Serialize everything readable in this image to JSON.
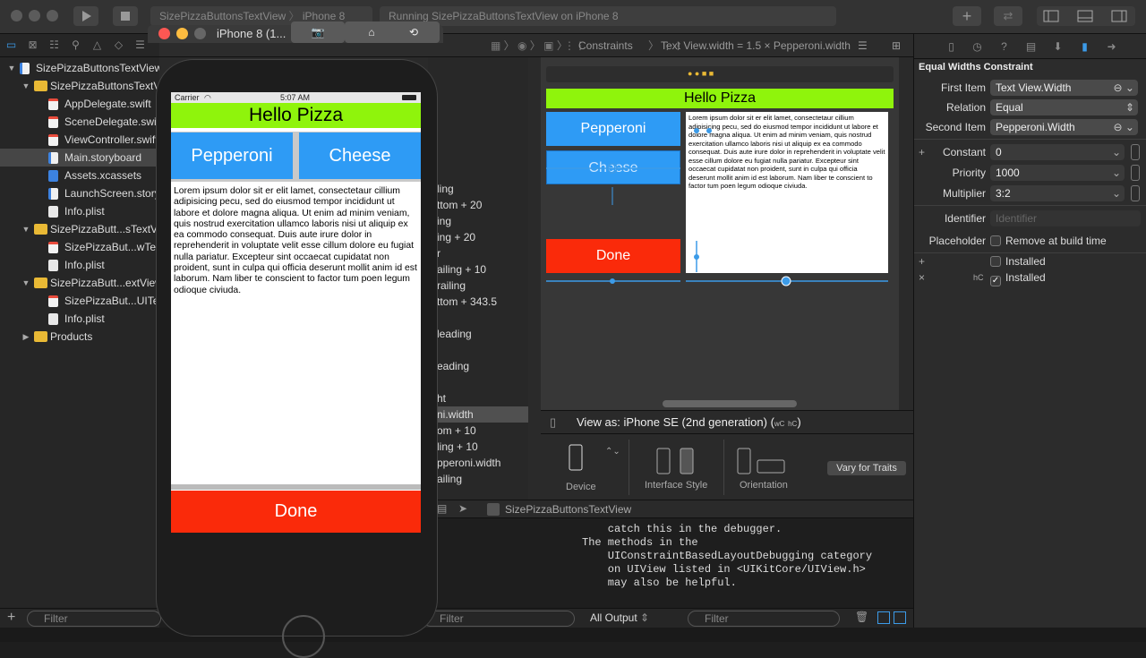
{
  "toolbar": {
    "scheme_left": "SizePizzaButtonsTextView",
    "scheme_device": "iPhone 8",
    "status": "Running SizePizzaButtonsTextView on iPhone 8"
  },
  "navigator": {
    "items": [
      {
        "label": "SizePizzaButtonsTextView",
        "kind": "project",
        "level": 0,
        "open": true
      },
      {
        "label": "SizePizzaButtonsTextView",
        "kind": "folder",
        "level": 1,
        "open": true
      },
      {
        "label": "AppDelegate.swift",
        "kind": "swift",
        "level": 2
      },
      {
        "label": "SceneDelegate.swift",
        "kind": "swift",
        "level": 2
      },
      {
        "label": "ViewController.swift",
        "kind": "swift",
        "level": 2
      },
      {
        "label": "Main.storyboard",
        "kind": "story",
        "level": 2,
        "selected": true
      },
      {
        "label": "Assets.xcassets",
        "kind": "assets",
        "level": 2
      },
      {
        "label": "LaunchScreen.storyboard",
        "kind": "story",
        "level": 2
      },
      {
        "label": "Info.plist",
        "kind": "plist",
        "level": 2
      },
      {
        "label": "SizePizzaButt...sTextView",
        "kind": "folder",
        "level": 1,
        "open": true
      },
      {
        "label": "SizePizzaBut...wTests.swift",
        "kind": "swift",
        "level": 2
      },
      {
        "label": "Info.plist",
        "kind": "plist",
        "level": 2
      },
      {
        "label": "SizePizzaButt...extViewUITests",
        "kind": "folder",
        "level": 1,
        "open": true
      },
      {
        "label": "SizePizzaBut...UITests.swift",
        "kind": "swift",
        "level": 2
      },
      {
        "label": "Info.plist",
        "kind": "plist",
        "level": 2
      },
      {
        "label": "Products",
        "kind": "folder",
        "level": 1,
        "open": false
      }
    ],
    "filter_placeholder": "Filter"
  },
  "jumpbar": {
    "crumb1": "Constraints",
    "crumb2": "Text View.width = 1.5 × Pepperoni.width"
  },
  "outline": {
    "items": [
      {
        "label": "ling"
      },
      {
        "label": "ttom + 20"
      },
      {
        "label": "ing"
      },
      {
        "label": "ing + 20"
      },
      {
        "label": "r"
      },
      {
        "label": "ailing + 10"
      },
      {
        "label": "railing"
      },
      {
        "label": "ttom + 343.5"
      },
      {
        "label": ""
      },
      {
        "label": "leading"
      },
      {
        "label": ""
      },
      {
        "label": "eading"
      },
      {
        "label": ""
      },
      {
        "label": "ht"
      },
      {
        "label": "ni.width",
        "selected": true
      },
      {
        "label": "om + 10"
      },
      {
        "label": "ling + 10"
      },
      {
        "label": "pperoni.width"
      },
      {
        "label": "ailing"
      }
    ]
  },
  "storyboard": {
    "title": "Hello Pizza",
    "btn_pepperoni": "Pepperoni",
    "btn_cheese": "Cheese",
    "btn_done": "Done",
    "body": "Lorem ipsum dolor sit er elit lamet, consectetaur cillium adipisicing pecu, sed do eiusmod tempor incididunt ut labore et dolore magna aliqua. Ut enim ad minim veniam, quis nostrud exercitation ullamco laboris nisi ut aliquip ex ea commodo consequat. Duis aute irure dolor in reprehenderit in voluptate velit esse cillum dolore eu fugiat nulla pariatur. Excepteur sint occaecat cupidatat non proident, sunt in culpa qui officia deserunt mollit anim id est laborum. Nam liber te conscient to factor tum poen legum odioque civiuda.",
    "view_as": "View as: iPhone SE (2nd generation) (",
    "view_as_w": "wC",
    "view_as_h": "hC",
    "view_as_end": ")",
    "device_label": "Device",
    "style_label": "Interface Style",
    "orientation_label": "Orientation",
    "vary_label": "Vary for Traits"
  },
  "debugbar": {
    "target": "SizePizzaButtonsTextView"
  },
  "console": {
    "text": "    catch this in the debugger.\nThe methods in the\n    UIConstraintBasedLayoutDebugging category\n    on UIView listed in <UIKitCore/UIView.h>\n    may also be helpful.",
    "output_select": "All Output",
    "filter_placeholder": "Filter",
    "left_filter_placeholder": "Filter"
  },
  "inspector": {
    "title": "Equal Widths Constraint",
    "first_item_label": "First Item",
    "first_item_value": "Text View.Width",
    "relation_label": "Relation",
    "relation_value": "Equal",
    "second_item_label": "Second Item",
    "second_item_value": "Pepperoni.Width",
    "constant_label": "Constant",
    "constant_value": "0",
    "priority_label": "Priority",
    "priority_value": "1000",
    "multiplier_label": "Multiplier",
    "multiplier_value": "3:2",
    "identifier_label": "Identifier",
    "identifier_placeholder": "Identifier",
    "placeholder_label": "Placeholder",
    "remove_label": "Remove at build time",
    "installed1_label": "Installed",
    "installed2_prefix": "hC",
    "installed2_label": "Installed"
  },
  "simulator": {
    "title": "iPhone 8 (1...",
    "carrier": "Carrier",
    "time": "5:07 AM",
    "title_text": "Hello Pizza",
    "btn_pepperoni": "Pepperoni",
    "btn_cheese": "Cheese",
    "btn_done": "Done",
    "body": "Lorem ipsum dolor sit er elit lamet, consectetaur cillium adipisicing pecu, sed do eiusmod tempor incididunt ut labore et dolore magna aliqua. Ut enim ad minim veniam, quis nostrud exercitation ullamco laboris nisi ut aliquip ex ea commodo consequat. Duis aute irure dolor in reprehenderit in voluptate velit esse cillum dolore eu fugiat nulla pariatur. Excepteur sint occaecat cupidatat non proident, sunt in culpa qui officia deserunt mollit anim id est laborum. Nam liber te conscient to factor tum poen legum odioque civiuda."
  },
  "colors": {
    "green": "#8ff40c",
    "blue": "#2e9bf5",
    "red": "#fa2a0a",
    "selected_row": "#464646"
  }
}
